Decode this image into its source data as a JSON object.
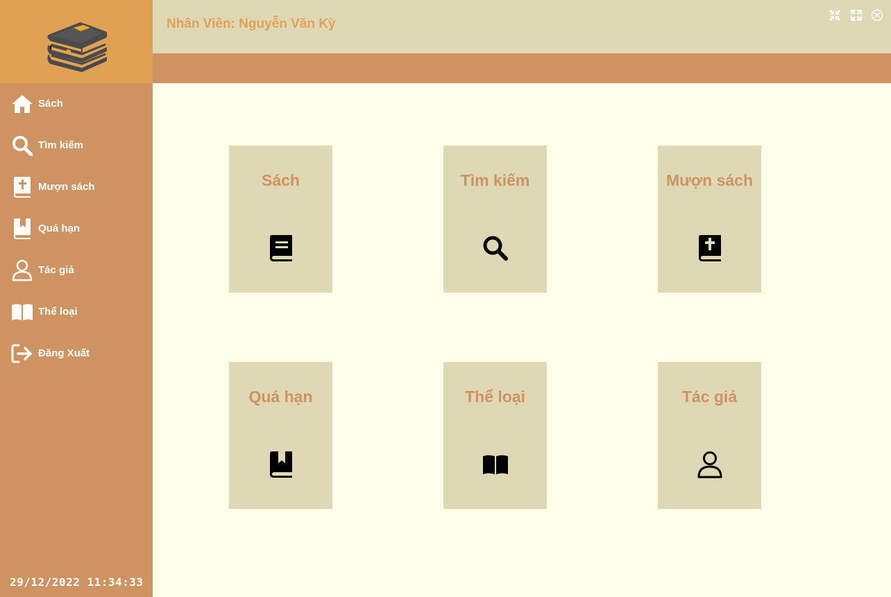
{
  "app": {
    "logo_icon": "stack-of-books-logo",
    "accent_color": "#e0a155",
    "sidebar_color": "#cf9361",
    "tile_color": "#dfd8b4",
    "content_bg": "#fdffea"
  },
  "header": {
    "employee_label": "Nhân Viên: Nguyễn Văn Kỳ",
    "window_controls": [
      "shrink-icon",
      "expand-icon",
      "close-circle-icon"
    ]
  },
  "sidebar": {
    "items": [
      {
        "label": "Sách",
        "icon": "home-icon"
      },
      {
        "label": "Tìm kiếm",
        "icon": "search-icon"
      },
      {
        "label": "Mượn sách",
        "icon": "bible-icon"
      },
      {
        "label": "Quá hạn",
        "icon": "bookmark-book-icon"
      },
      {
        "label": "Tác giả",
        "icon": "user-icon"
      },
      {
        "label": "Thể loại",
        "icon": "open-book-icon"
      },
      {
        "label": "Đăng Xuất",
        "icon": "logout-icon"
      }
    ],
    "datetime": "29/12/2022 11:34:33"
  },
  "tiles": [
    {
      "label": "Sách",
      "icon": "book-icon"
    },
    {
      "label": "Tìm kiếm",
      "icon": "search-icon"
    },
    {
      "label": "Mượn sách",
      "icon": "bible-icon"
    },
    {
      "label": "Quá hạn",
      "icon": "bookmark-book-icon"
    },
    {
      "label": "Thể loại",
      "icon": "open-book-icon"
    },
    {
      "label": "Tác giả",
      "icon": "user-icon"
    }
  ]
}
